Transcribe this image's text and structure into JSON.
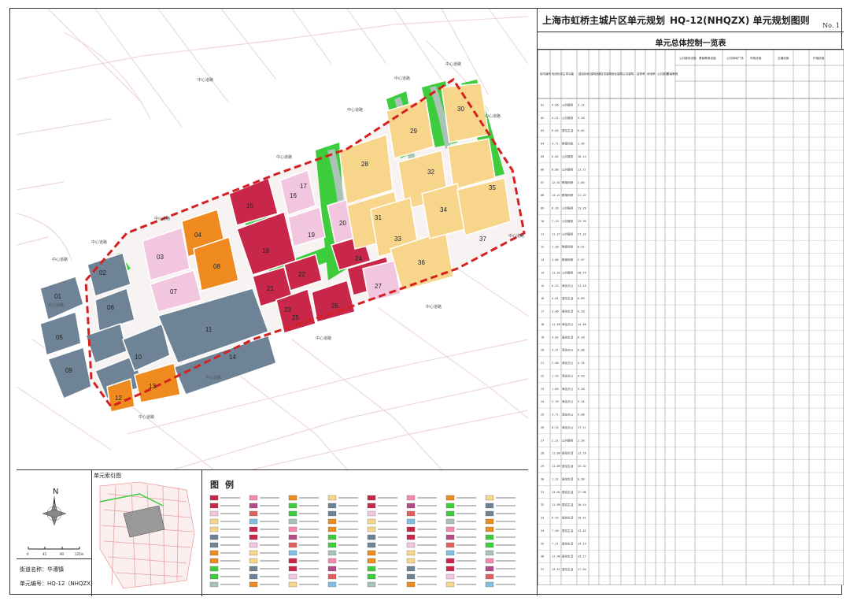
{
  "header": {
    "title": "上海市虹桥主城片区单元规划",
    "code": "HQ-12(NHQZX)",
    "subtitle": "单元规划图则",
    "sheet_no": "No. 1"
  },
  "table": {
    "title": "单元总体控制一览表",
    "columns": [
      "街坊编号",
      "规划街坊面积",
      "主导功能",
      "建设用地面积",
      "建筑面积",
      "住宅建筑面积",
      "商业建筑面积",
      "公共建筑面积",
      "容积率",
      "绿地率",
      "公共服务设施",
      "基础教育设施",
      "市政交通设施",
      "公共绿地广场",
      "文化设施",
      "体育设施",
      "其他"
    ],
    "groups": [
      "公共服务设施",
      "基础教育设施",
      "公共绿地广场",
      "市政设施",
      "交通设施",
      "环境设施"
    ],
    "rows": [
      {
        "no": "01",
        "area": "4.66",
        "func": "公共服务",
        "val": "3.14"
      },
      {
        "no": "02",
        "area": "4.22",
        "func": "公共服务",
        "val": "3.28"
      },
      {
        "no": "03",
        "area": "6.02",
        "func": "居住生活",
        "val": "6.02"
      },
      {
        "no": "04",
        "area": "4.71",
        "func": "教育科研",
        "val": "1.96"
      },
      {
        "no": "05",
        "area": "6.02",
        "func": "公共服务",
        "val": "16.14"
      },
      {
        "no": "06",
        "area": "8.88",
        "func": "公共服务",
        "val": "11.71"
      },
      {
        "no": "07",
        "area": "12.61",
        "func": "教育科研",
        "val": "2.60"
      },
      {
        "no": "08",
        "area": "14.21",
        "func": "教育科研",
        "val": "11.22"
      },
      {
        "no": "09",
        "area": "6.26",
        "func": "公共服务",
        "val": "13.26"
      },
      {
        "no": "10",
        "area": "7.13",
        "func": "公共服务",
        "val": "13.39"
      },
      {
        "no": "11",
        "area": "11.27",
        "func": "公共服务",
        "val": "27.32"
      },
      {
        "no": "12",
        "area": "1.28",
        "func": "教育科研",
        "val": "0.52"
      },
      {
        "no": "13",
        "area": "4.86",
        "func": "教育科研",
        "val": "2.97"
      },
      {
        "no": "14",
        "area": "11.32",
        "func": "公共服务",
        "val": "28.79"
      },
      {
        "no": "15",
        "area": "6.23",
        "func": "商业办公",
        "val": "11.16"
      },
      {
        "no": "16",
        "area": "4.81",
        "func": "居住生活",
        "val": "6.89"
      },
      {
        "no": "17",
        "area": "3.06",
        "func": "居住生活",
        "val": "6.58"
      },
      {
        "no": "18",
        "area": "11.48",
        "func": "商业办公",
        "val": "14.66"
      },
      {
        "no": "19",
        "area": "3.02",
        "func": "居住生活",
        "val": "6.20"
      },
      {
        "no": "20",
        "area": "3.37",
        "func": "商业办公",
        "val": "6.88"
      },
      {
        "no": "21",
        "area": "2.00",
        "func": "商业办公",
        "val": "4.16"
      },
      {
        "no": "22",
        "area": "1.93",
        "func": "商业办公",
        "val": "4.59"
      },
      {
        "no": "23",
        "area": "1.83",
        "func": "商业办公",
        "val": "3.28"
      },
      {
        "no": "24",
        "area": "2.76",
        "func": "商业办公",
        "val": "5.18"
      },
      {
        "no": "25",
        "area": "3.71",
        "func": "商业办公",
        "val": "9.88"
      },
      {
        "no": "26",
        "area": "8.15",
        "func": "商业办公",
        "val": "17.11"
      },
      {
        "no": "27",
        "area": "2.21",
        "func": "公共服务",
        "val": "1.58"
      },
      {
        "no": "28",
        "area": "11.00",
        "func": "居住生活",
        "val": "12.16"
      },
      {
        "no": "29",
        "area": "11.09",
        "func": "居住生活",
        "val": "15.32"
      },
      {
        "no": "30",
        "area": "1.31",
        "func": "居住生活",
        "val": "0.98"
      },
      {
        "no": "31",
        "area": "13.01",
        "func": "居住生活",
        "val": "17.06"
      },
      {
        "no": "32",
        "area": "11.09",
        "func": "居住生活",
        "val": "16.14"
      },
      {
        "no": "33",
        "area": "6.93",
        "func": "居住生活",
        "val": "10.41"
      },
      {
        "no": "34",
        "area": "7.20",
        "func": "居住生活",
        "val": "13.02"
      },
      {
        "no": "35",
        "area": "7.21",
        "func": "居住生活",
        "val": "14.19"
      },
      {
        "no": "36",
        "area": "11.96",
        "func": "居住生活",
        "val": "15.17"
      },
      {
        "no": "37",
        "area": "13.51",
        "func": "居住生活",
        "val": "17.04"
      }
    ]
  },
  "map": {
    "parcels": [
      "01",
      "02",
      "03",
      "04",
      "05",
      "06",
      "07",
      "08",
      "09",
      "10",
      "11",
      "12",
      "13",
      "14",
      "15",
      "16",
      "17",
      "18",
      "19",
      "20",
      "21",
      "22",
      "23",
      "24",
      "25",
      "26",
      "27",
      "28",
      "29",
      "30",
      "31",
      "32",
      "33",
      "34",
      "35",
      "36",
      "37"
    ],
    "road_label": "中心道路",
    "colors": {
      "public_service": "#6e8496",
      "education": "#ef8a1e",
      "commercial": "#c8274a",
      "residential": "#f7d58a",
      "green": "#3ccc3c",
      "river": "#a9c4b5",
      "boundary": "#d42020",
      "mixed": "#f2c6df"
    }
  },
  "bottom": {
    "index_caption": "单元索引图",
    "legend_caption": "图例",
    "street_name": "街道名称：华漕镇",
    "unit_code": "单元编号：HQ-12（NHQZX）",
    "north": "N",
    "scale": [
      "0",
      "45",
      "90",
      "135m"
    ]
  }
}
